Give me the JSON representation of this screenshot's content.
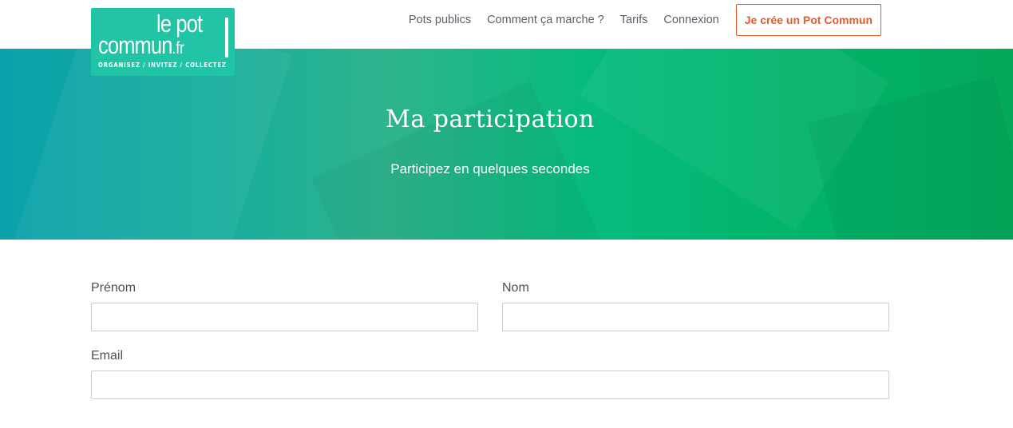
{
  "brand": {
    "logo_line1": "le pot",
    "logo_line2_main": "commun",
    "logo_line2_tld": ".fr",
    "tagline": "ORGANISEZ / INVITEZ / COLLECTEZ",
    "logo_color": "#21c4a4"
  },
  "nav": {
    "items": [
      {
        "label": "Pots publics"
      },
      {
        "label": "Comment ça marche ?"
      },
      {
        "label": "Tarifs"
      },
      {
        "label": "Connexion"
      }
    ],
    "cta_label": "Je crée un Pot Commun",
    "cta_color": "#ea5a2a"
  },
  "hero": {
    "title": "Ma participation",
    "subtitle": "Participez en quelques secondes"
  },
  "form": {
    "first_name": {
      "label": "Prénom",
      "value": "",
      "placeholder": ""
    },
    "last_name": {
      "label": "Nom",
      "value": "",
      "placeholder": ""
    },
    "email": {
      "label": "Email",
      "value": "",
      "placeholder": ""
    }
  }
}
